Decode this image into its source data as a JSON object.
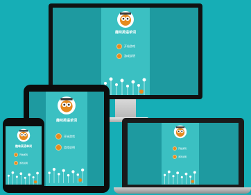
{
  "app": {
    "title": "趣味英语单词",
    "menu": [
      {
        "label": "开始游戏",
        "icon": "bullet-icon"
      },
      {
        "label": "游戏说明",
        "icon": "bullet-icon"
      }
    ]
  },
  "colors": {
    "background": "#16aeb6",
    "screen": "#1e9aa0",
    "panel": "#3bc0c2",
    "accent": "#e68a1e"
  },
  "devices": [
    "desktop-monitor",
    "tablet",
    "smartphone",
    "laptop"
  ]
}
